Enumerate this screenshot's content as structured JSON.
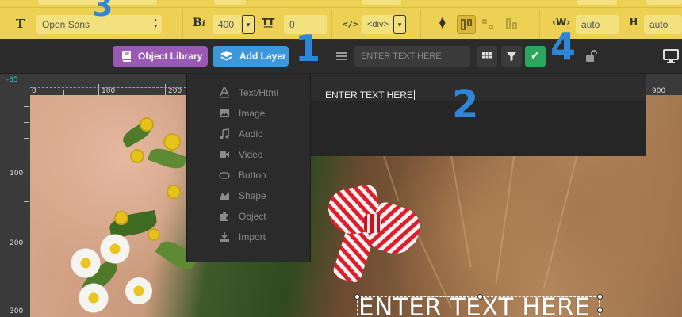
{
  "topbar": {
    "font_family": "Open Sans",
    "font_weight": "400",
    "letter_spacing": "0",
    "tag": "<div>",
    "width_label": "W",
    "width_value": "auto",
    "height_label": "H",
    "height_value": "auto",
    "accent_color": "#ecd154"
  },
  "toolbar2": {
    "object_library_label": "Object Library",
    "add_layer_label": "Add Layer",
    "text_input_value": "ENTER TEXT HERE",
    "confirm_glyph": "✓",
    "library_color": "#9b59b6",
    "add_layer_color": "#3d97db",
    "confirm_color": "#2ea55f"
  },
  "rulers": {
    "offset_badge": "-35",
    "top_ticks": [
      "0",
      "100",
      "200",
      "900"
    ],
    "left_ticks": [
      "100",
      "200",
      "300"
    ]
  },
  "layer_menu": {
    "items": [
      {
        "label": "Text/Html",
        "icon": "text-icon"
      },
      {
        "label": "Image",
        "icon": "image-icon"
      },
      {
        "label": "Audio",
        "icon": "music-icon"
      },
      {
        "label": "Video",
        "icon": "video-icon"
      },
      {
        "label": "Button",
        "icon": "button-icon"
      },
      {
        "label": "Shape",
        "icon": "shape-icon"
      },
      {
        "label": "Object",
        "icon": "puzzle-icon"
      },
      {
        "label": "Import",
        "icon": "import-icon"
      }
    ]
  },
  "text_panel": {
    "value": "ENTER TEXT HERE"
  },
  "canvas": {
    "layer_text": "ENTER TEXT HERE"
  },
  "callouts": [
    "1",
    "2",
    "3",
    "4"
  ]
}
